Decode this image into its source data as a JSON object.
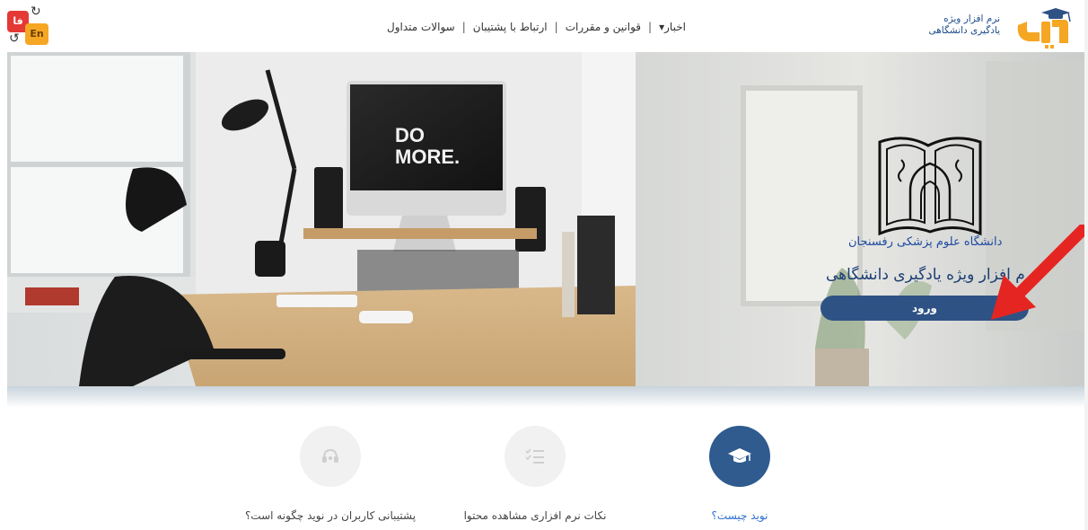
{
  "lang_switch": {
    "fa_label": "فا",
    "en_label": "En"
  },
  "nav": {
    "items": [
      "سوالات متداول",
      "ارتباط با پشتیبان",
      "قوانین و مقررات",
      "اخبار▾"
    ],
    "separator": "|"
  },
  "brand": {
    "line1": "نرم افزار ویژه",
    "line2": "یادگیری دانشگاهی"
  },
  "hero": {
    "monitor_text_1": "DO",
    "monitor_text_2": "MORE.",
    "university_name": "دانشگاه علوم پزشکی رفسنجان",
    "system_title": "نرم افزار ویژه یادگیری دانشگاهی",
    "login_label": "ورود"
  },
  "features": [
    {
      "caption": "نوید چیست؟",
      "icon": "graduation-cap-icon"
    },
    {
      "caption": "نکات نرم افزاری مشاهده محتوا",
      "icon": "checklist-icon"
    },
    {
      "caption": "پشتیبانی کاربران در نوید چگونه است؟",
      "icon": "headset-icon"
    }
  ],
  "colors": {
    "primary": "#2f5285",
    "accent_red": "#e52521",
    "link_blue": "#2e6fd0"
  }
}
